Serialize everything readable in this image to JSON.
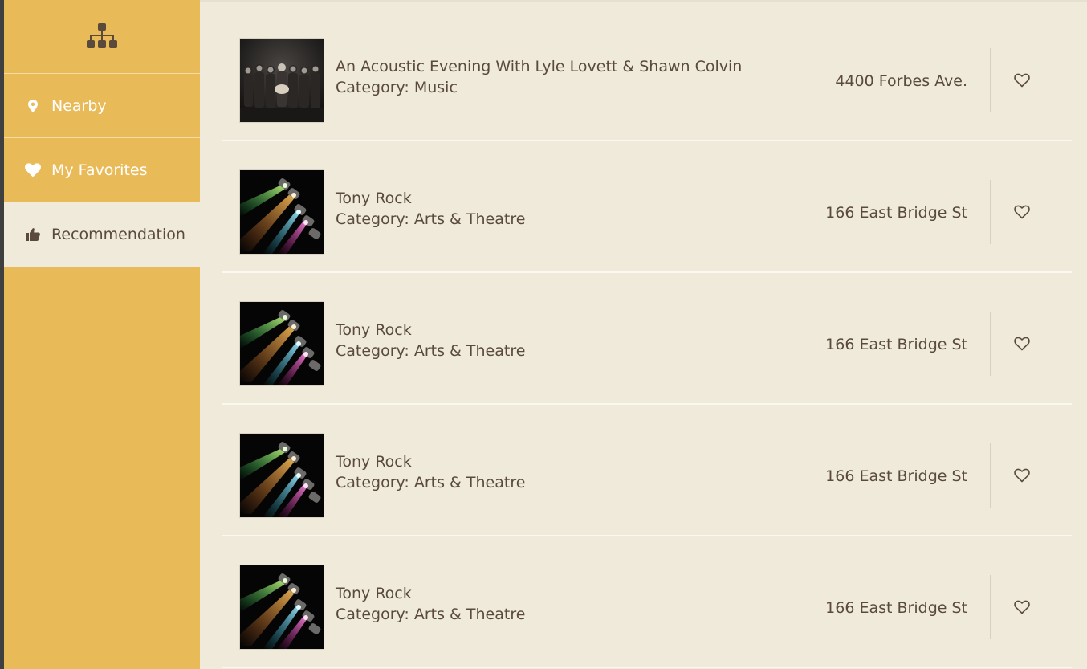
{
  "sidebar": {
    "logo_icon": "sitemap-icon",
    "items": [
      {
        "label": "Nearby",
        "icon": "map-marker-icon"
      },
      {
        "label": "My Favorites",
        "icon": "heart-icon"
      },
      {
        "label": "Recommendation",
        "icon": "thumbs-up-icon"
      }
    ],
    "active_index": 2
  },
  "items": [
    {
      "name": "An Acoustic Evening With Lyle Lovett & Shawn Colvin",
      "category": "Category: Music",
      "address": "4400 Forbes Ave.",
      "thumb": "band-photo"
    },
    {
      "name": "Tony Rock",
      "category": "Category: Arts & Theatre",
      "address": "166 East Bridge St",
      "thumb": "stage-lights"
    },
    {
      "name": "Tony Rock",
      "category": "Category: Arts & Theatre",
      "address": "166 East Bridge St",
      "thumb": "stage-lights"
    },
    {
      "name": "Tony Rock",
      "category": "Category: Arts & Theatre",
      "address": "166 East Bridge St",
      "thumb": "stage-lights"
    },
    {
      "name": "Tony Rock",
      "category": "Category: Arts & Theatre",
      "address": "166 East Bridge St",
      "thumb": "stage-lights"
    }
  ],
  "colors": {
    "sidebar": "#e9ba58",
    "background": "#f0eadb",
    "text": "#5a4a3c"
  }
}
